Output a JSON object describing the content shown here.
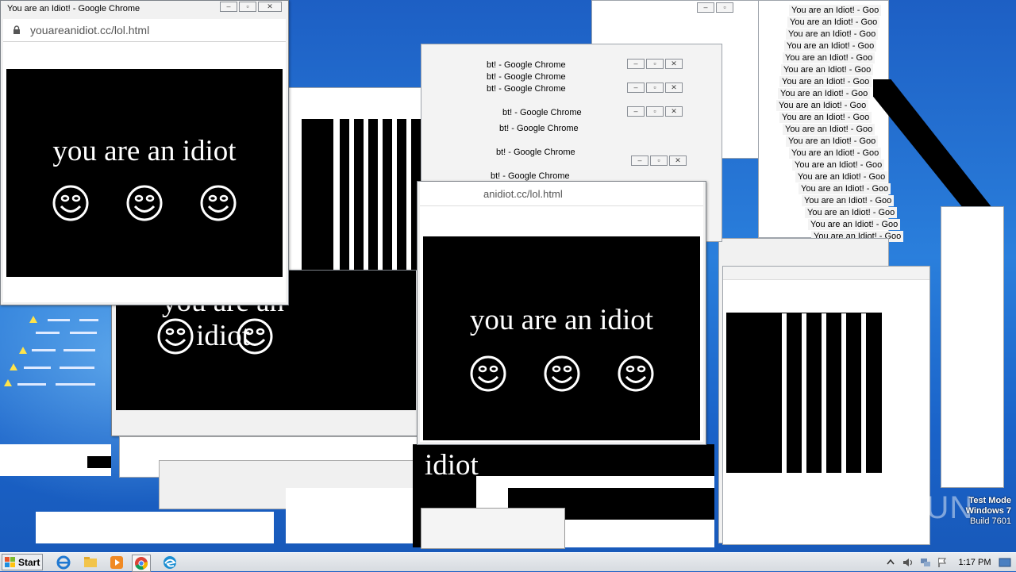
{
  "app": {
    "window_title": "You are an Idiot! - Google Chrome",
    "url": "youareanidiot.cc/lol.html",
    "partial_url": "anidiot.cc/lol.html",
    "page_text": "you are an idiot",
    "fragment_text": "idiot"
  },
  "cascade": {
    "title_fragment_a": "bt! - Google Chrome",
    "title_fragment_b": "You are an Idiot! - Goo",
    "title_fragment_c": "Google"
  },
  "taskbar": {
    "start_label": "Start",
    "clock": "1:17 PM",
    "icons": [
      "ie-icon",
      "explorer-icon",
      "media-player-icon",
      "chrome-icon",
      "edge-icon"
    ]
  },
  "watermark": {
    "line1": "Test Mode",
    "line2": "Windows 7",
    "line3": "Build 7601",
    "brand": "ANY RUN"
  },
  "colors": {
    "desktop_blue": "#1d5fc4",
    "stage_black": "#000000",
    "text_white": "#ffffff"
  }
}
